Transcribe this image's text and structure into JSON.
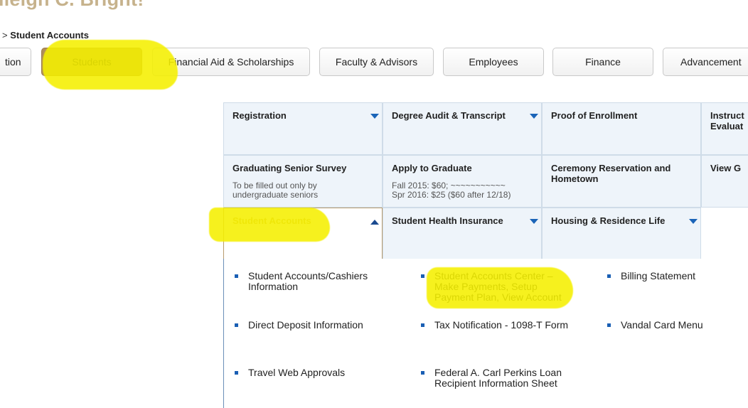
{
  "header": {
    "greeting_fragment": "ileigh C. Bright!",
    "breadcrumb_sep": ">",
    "breadcrumb_current": "Student Accounts"
  },
  "tabs": [
    {
      "label": "tion"
    },
    {
      "label": "Students",
      "active": true
    },
    {
      "label": "Financial Aid & Scholarships"
    },
    {
      "label": "Faculty & Advisors"
    },
    {
      "label": "Employees"
    },
    {
      "label": "Finance"
    },
    {
      "label": "Advancement"
    }
  ],
  "grid": {
    "row1": [
      {
        "title": "Registration"
      },
      {
        "title": "Degree Audit & Transcript"
      },
      {
        "title": "Proof of Enrollment"
      },
      {
        "title": "Instruct Evaluat"
      }
    ],
    "row2": [
      {
        "title": "Graduating Senior Survey",
        "sub": "To be filled out only by undergraduate seniors"
      },
      {
        "title": "Apply to Graduate",
        "sub_line1": "Fall 2015: $60; ~~~~~~~~~~~",
        "sub_line2": "Spr 2016: $25 ($60 after 12/18)"
      },
      {
        "title": "Ceremony Reservation and Hometown"
      },
      {
        "title": "View G"
      }
    ],
    "row3": [
      {
        "title": "Student Accounts",
        "expanded": true
      },
      {
        "title": "Student Health Insurance"
      },
      {
        "title": "Housing & Residence Life"
      }
    ]
  },
  "dropdown_links": [
    {
      "line1": "Student Accounts/Cashiers",
      "line2": "Information"
    },
    {
      "line1": "Student Accounts Center –",
      "line2": "Make Payments, Setup",
      "line3": "Payment Plan, View Account"
    },
    {
      "line1": "Billing Statement"
    },
    {
      "line1": "Direct Deposit Information"
    },
    {
      "line1": "Tax Notification - 1098-T Form"
    },
    {
      "line1": "Vandal Card Menu"
    },
    {
      "line1": "Travel Web Approvals"
    },
    {
      "line1": "Federal A. Carl Perkins Loan",
      "line2": "Recipient Information Sheet"
    }
  ],
  "colors": {
    "highlight": "#f5f000",
    "active_tab": "#b08d5b",
    "cell_bg": "#eef4fa",
    "link_bullet": "#1a5fb4",
    "greeting": "#c6b28c"
  }
}
